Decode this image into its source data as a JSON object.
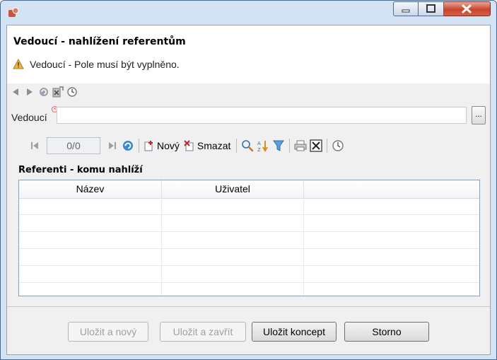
{
  "window": {
    "icon": "app-icon",
    "controls": [
      "minimize-icon",
      "maximize-icon",
      "close-icon"
    ]
  },
  "header": {
    "title": "Vedoucí - nahlížení referentům",
    "warning_text": "Vedoucí - Pole musí být vyplněno."
  },
  "navbar": {
    "icons": [
      "back-icon",
      "forward-icon",
      "refresh-icon",
      "export-icon",
      "history-icon"
    ]
  },
  "field": {
    "label": "Vedoucí",
    "value": "",
    "browse_label": "..."
  },
  "gridbar": {
    "page_indicator": "0/0",
    "new_label": "Nový",
    "delete_label": "Smazat"
  },
  "section": {
    "title": "Referenti - komu nahlíží"
  },
  "grid": {
    "columns": [
      "Název",
      "Uživatel",
      ""
    ],
    "rows": []
  },
  "footer": {
    "save_new": "Uložit a nový",
    "save_close": "Uložit a zavřít",
    "save_draft": "Uložit koncept",
    "cancel": "Storno"
  },
  "colors": {
    "frame": "#d3e3f3",
    "close": "#c7442b",
    "warning": "#e6a23c"
  }
}
